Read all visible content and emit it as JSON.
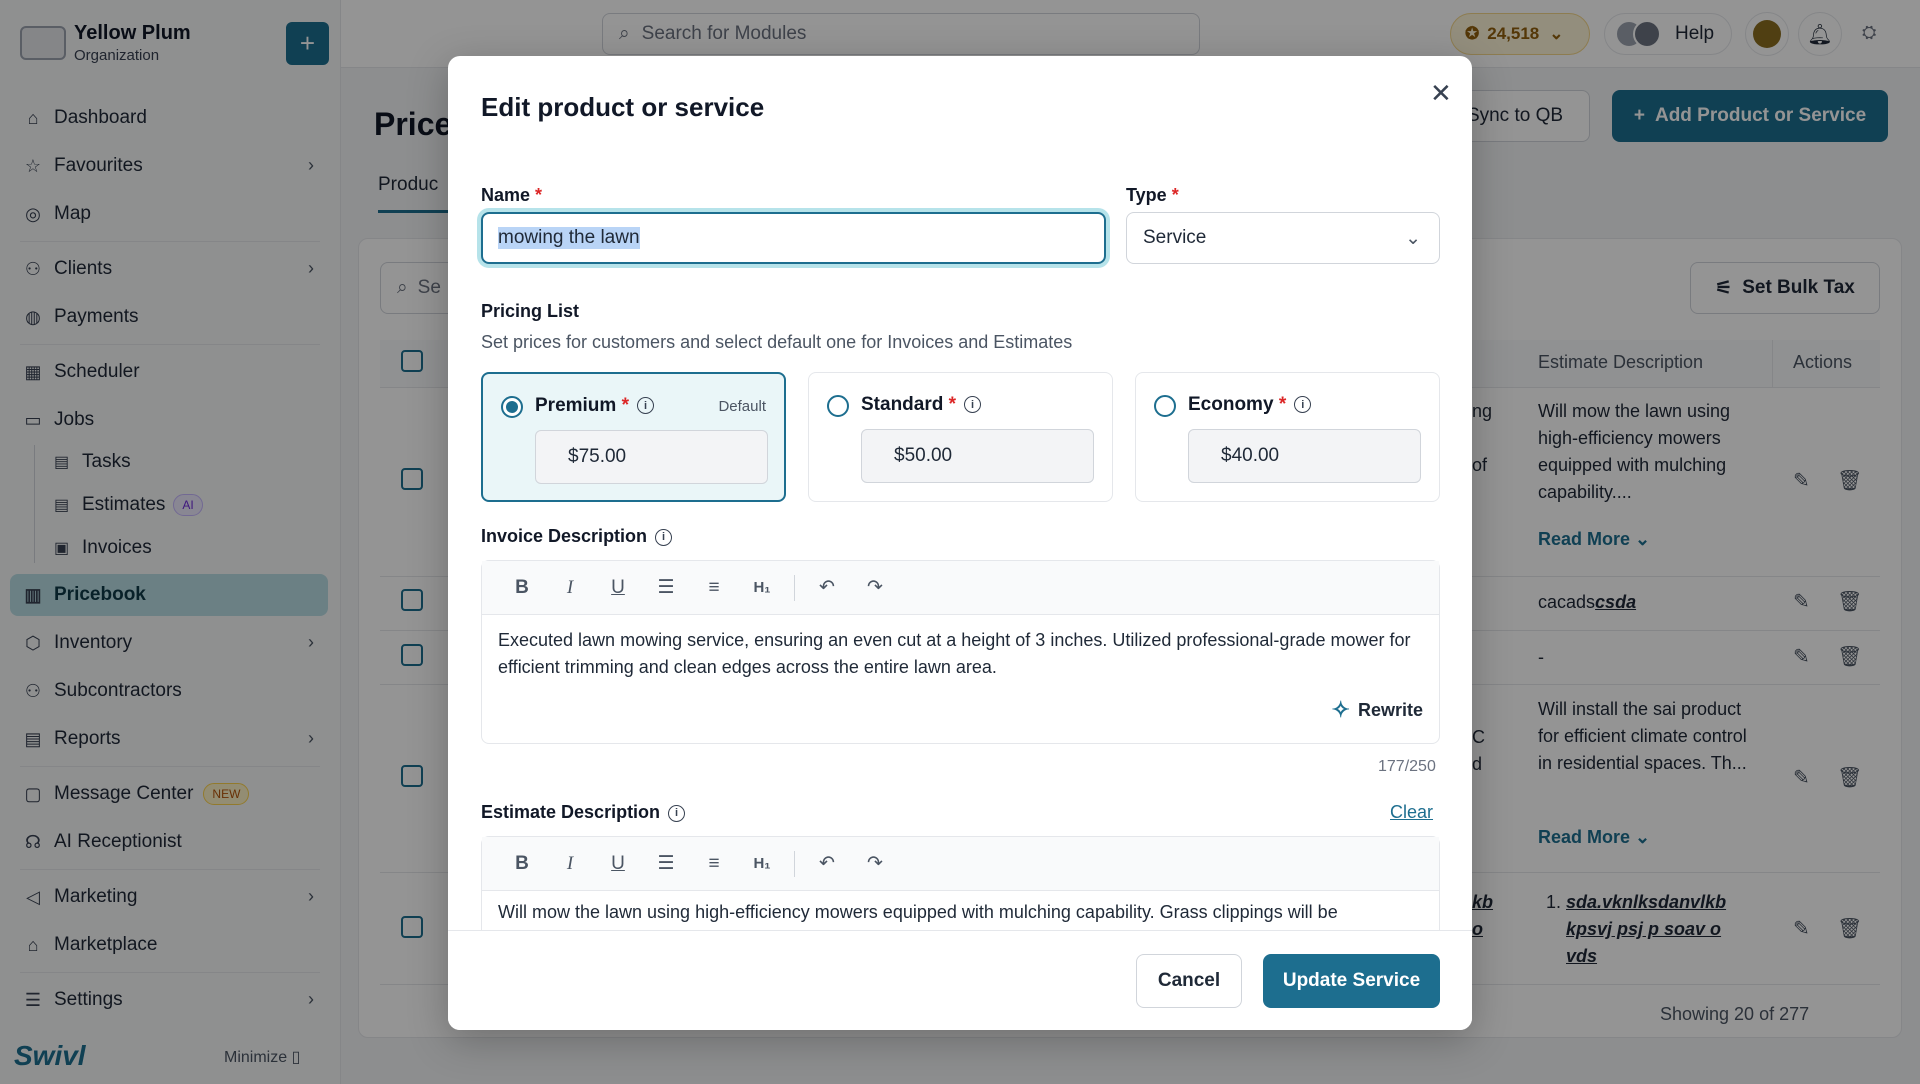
{
  "org": {
    "name": "Yellow Plum",
    "subtitle": "Organization"
  },
  "sidebar": {
    "items": [
      {
        "label": "Dashboard"
      },
      {
        "label": "Favourites"
      },
      {
        "label": "Map"
      },
      {
        "label": "Clients"
      },
      {
        "label": "Payments"
      },
      {
        "label": "Scheduler"
      },
      {
        "label": "Jobs"
      },
      {
        "label": "Pricebook"
      },
      {
        "label": "Inventory"
      },
      {
        "label": "Subcontractors"
      },
      {
        "label": "Reports"
      },
      {
        "label": "Message Center"
      },
      {
        "label": "AI Receptionist"
      },
      {
        "label": "Marketing"
      },
      {
        "label": "Marketplace"
      },
      {
        "label": "Settings"
      }
    ],
    "jobs_sub": [
      {
        "label": "Tasks"
      },
      {
        "label": "Estimates"
      },
      {
        "label": "Invoices"
      }
    ],
    "ai_badge": "AI",
    "new_badge": "NEW",
    "brand": "Swivl",
    "minimize": "Minimize"
  },
  "topbar": {
    "search_placeholder": "Search for Modules",
    "coins": "24,518",
    "help": "Help"
  },
  "page": {
    "title": "Price",
    "tab": "Produc",
    "sync_button": "Sync to QB",
    "add_button": "Add Product or Service",
    "bulk_tax": "Set Bulk Tax",
    "search_partial": "Se",
    "columns": {
      "estimate_description": "Estimate Description",
      "actions": "Actions"
    },
    "rows": [
      {
        "frag": "ng",
        "frag2": "of",
        "desc": "Will mow the lawn using high-efficiency mowers equipped with mulching capability....",
        "read_more": "Read More"
      },
      {
        "desc_plain": "cacads",
        "desc_link": "csda"
      },
      {
        "desc": "-"
      },
      {
        "frag": "C",
        "frag2": "d",
        "desc": "Will install the sai product for efficient climate control in residential spaces. Th...",
        "read_more": "Read More"
      },
      {
        "frag": "kb",
        "frag2": "o",
        "list_item": "sda.vknlksdanvlkb kpsvj psj p soav o vds"
      }
    ],
    "showing": "Showing 20 of 277"
  },
  "modal": {
    "title": "Edit product or service",
    "name_label": "Name",
    "name_value": "mowing the lawn",
    "type_label": "Type",
    "type_value": "Service",
    "pricing_title": "Pricing List",
    "pricing_subtitle": "Set prices for customers and select default one for Invoices and Estimates",
    "price_tiers": [
      {
        "name": "Premium",
        "price": "$75.00",
        "default": "Default",
        "selected": true
      },
      {
        "name": "Standard",
        "price": "$50.00",
        "selected": false
      },
      {
        "name": "Economy",
        "price": "$40.00",
        "selected": false
      }
    ],
    "invoice_label": "Invoice Description",
    "invoice_text": "Executed lawn mowing service, ensuring an even cut at a height of 3 inches. Utilized professional-grade mower for efficient trimming and clean edges across the entire lawn area.",
    "rewrite": "Rewrite",
    "counter": "177/250",
    "estimate_label": "Estimate Description",
    "clear": "Clear",
    "estimate_text": "Will mow the lawn using high-efficiency mowers equipped with mulching capability. Grass clippings will be",
    "cancel": "Cancel",
    "update": "Update Service"
  },
  "colors": {
    "accent": "#1d6e8f",
    "required": "#dc2626",
    "highlight": "#b9d4f6"
  }
}
